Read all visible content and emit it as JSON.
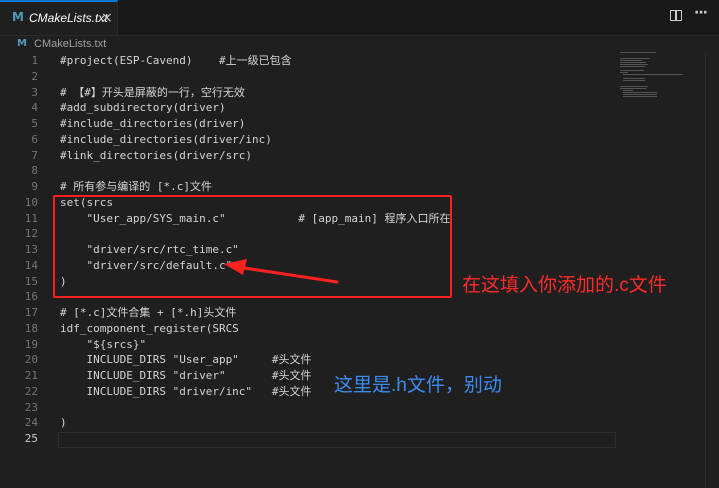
{
  "tab": {
    "icon": "M",
    "title": "CMakeLists.txt",
    "close": "×"
  },
  "toolbar": {
    "split_icon": "split-editor-icon",
    "more_icon": "···"
  },
  "breadcrumb": {
    "icon": "M",
    "file": "CMakeLists.txt"
  },
  "lines": [
    {
      "n": "1",
      "t": "#project(ESP-Cavend)    #上一级已包含"
    },
    {
      "n": "2",
      "t": ""
    },
    {
      "n": "3",
      "t": "# 【#】开头是屏蔽的一行，空行无效"
    },
    {
      "n": "4",
      "t": "#add_subdirectory(driver)"
    },
    {
      "n": "5",
      "t": "#include_directories(driver)"
    },
    {
      "n": "6",
      "t": "#include_directories(driver/inc)"
    },
    {
      "n": "7",
      "t": "#link_directories(driver/src)"
    },
    {
      "n": "8",
      "t": ""
    },
    {
      "n": "9",
      "t": "# 所有参与编译的 [*.c]文件"
    },
    {
      "n": "10",
      "t": "set(srcs"
    },
    {
      "n": "11",
      "t": "    \"User_app/SYS_main.c\"           # [app_main] 程序入口所在"
    },
    {
      "n": "12",
      "t": ""
    },
    {
      "n": "13",
      "t": "    \"driver/src/rtc_time.c\""
    },
    {
      "n": "14",
      "t": "    \"driver/src/default.c\""
    },
    {
      "n": "15",
      "t": ")"
    },
    {
      "n": "16",
      "t": ""
    },
    {
      "n": "17",
      "t": "# [*.c]文件合集 + [*.h]头文件"
    },
    {
      "n": "18",
      "t": "idf_component_register(SRCS"
    },
    {
      "n": "19",
      "t": "    \"${srcs}\""
    },
    {
      "n": "20",
      "t": "    INCLUDE_DIRS \"User_app\"     #头文件"
    },
    {
      "n": "21",
      "t": "    INCLUDE_DIRS \"driver\"       #头文件"
    },
    {
      "n": "22",
      "t": "    INCLUDE_DIRS \"driver/inc\"   #头文件"
    },
    {
      "n": "23",
      "t": ""
    },
    {
      "n": "24",
      "t": ")"
    },
    {
      "n": "25",
      "t": ""
    }
  ],
  "annotations": {
    "red_note": "在这填入你添加的.c文件",
    "blue_note": "这里是.h文件，别动"
  },
  "colors": {
    "accent": "#0078d4",
    "annotation_red": "#ff2020",
    "annotation_blue": "#3b8cf0"
  }
}
